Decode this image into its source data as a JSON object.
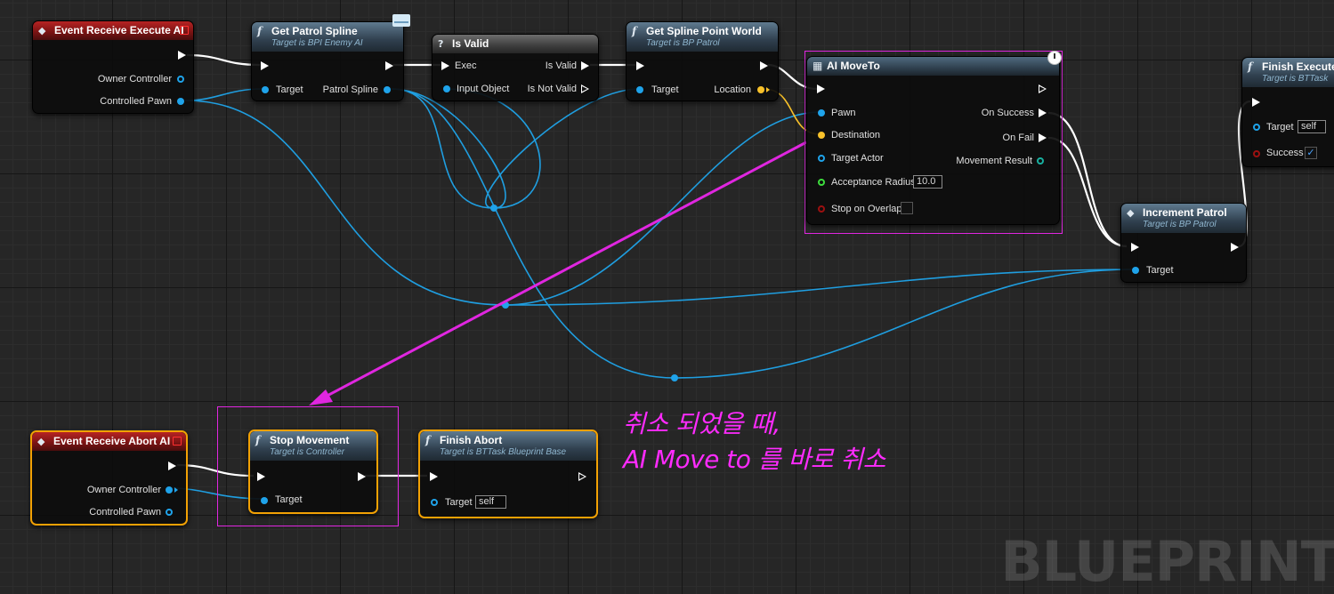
{
  "nodes": {
    "event_execute": {
      "title": "Event Receive Execute AI",
      "pins": {
        "owner_controller": "Owner Controller",
        "controlled_pawn": "Controlled Pawn"
      }
    },
    "get_patrol_spline": {
      "title": "Get Patrol Spline",
      "subtitle": "Target is BPI Enemy AI",
      "pins": {
        "target": "Target",
        "patrol_spline": "Patrol Spline"
      }
    },
    "is_valid": {
      "title": "Is Valid",
      "pins": {
        "exec": "Exec",
        "is_valid": "Is Valid",
        "input_object": "Input Object",
        "is_not_valid": "Is Not Valid"
      }
    },
    "get_spline_point": {
      "title": "Get Spline Point World",
      "subtitle": "Target is BP Patrol",
      "pins": {
        "target": "Target",
        "location": "Location"
      }
    },
    "ai_move_to": {
      "title": "AI MoveTo",
      "pins": {
        "pawn": "Pawn",
        "destination": "Destination",
        "target_actor": "Target Actor",
        "acceptance_radius": "Acceptance Radius",
        "acceptance_radius_value": "10.0",
        "stop_on_overlap": "Stop on Overlap",
        "on_success": "On Success",
        "on_fail": "On Fail",
        "movement_result": "Movement Result"
      }
    },
    "finish_execute": {
      "title": "Finish Execute",
      "subtitle": "Target is BTTask",
      "pins": {
        "target": "Target",
        "target_value": "self",
        "success": "Success"
      }
    },
    "increment_patrol": {
      "title": "Increment Patrol",
      "subtitle": "Target is BP Patrol",
      "pins": {
        "target": "Target"
      }
    },
    "event_abort": {
      "title": "Event Receive Abort AI",
      "pins": {
        "owner_controller": "Owner Controller",
        "controlled_pawn": "Controlled Pawn"
      }
    },
    "stop_movement": {
      "title": "Stop Movement",
      "subtitle": "Target is Controller",
      "pins": {
        "target": "Target"
      }
    },
    "finish_abort": {
      "title": "Finish Abort",
      "subtitle": "Target is BTTask Blueprint Base",
      "pins": {
        "target": "Target",
        "target_value": "self"
      }
    }
  },
  "annotation": {
    "line1": "취소 되었을 때,",
    "line2": "AI Move to 를 바로 취소"
  },
  "watermark": "BLUEPRINT",
  "icons": {
    "function": "f",
    "event": "◆",
    "macro": "?",
    "async": "▦"
  },
  "colors": {
    "exec_wire": "#ffffff",
    "object_wire": "#1f9ee0",
    "vector_wire": "#f8c12a",
    "annotation": "#e026e0",
    "selection": "#f2a104"
  }
}
